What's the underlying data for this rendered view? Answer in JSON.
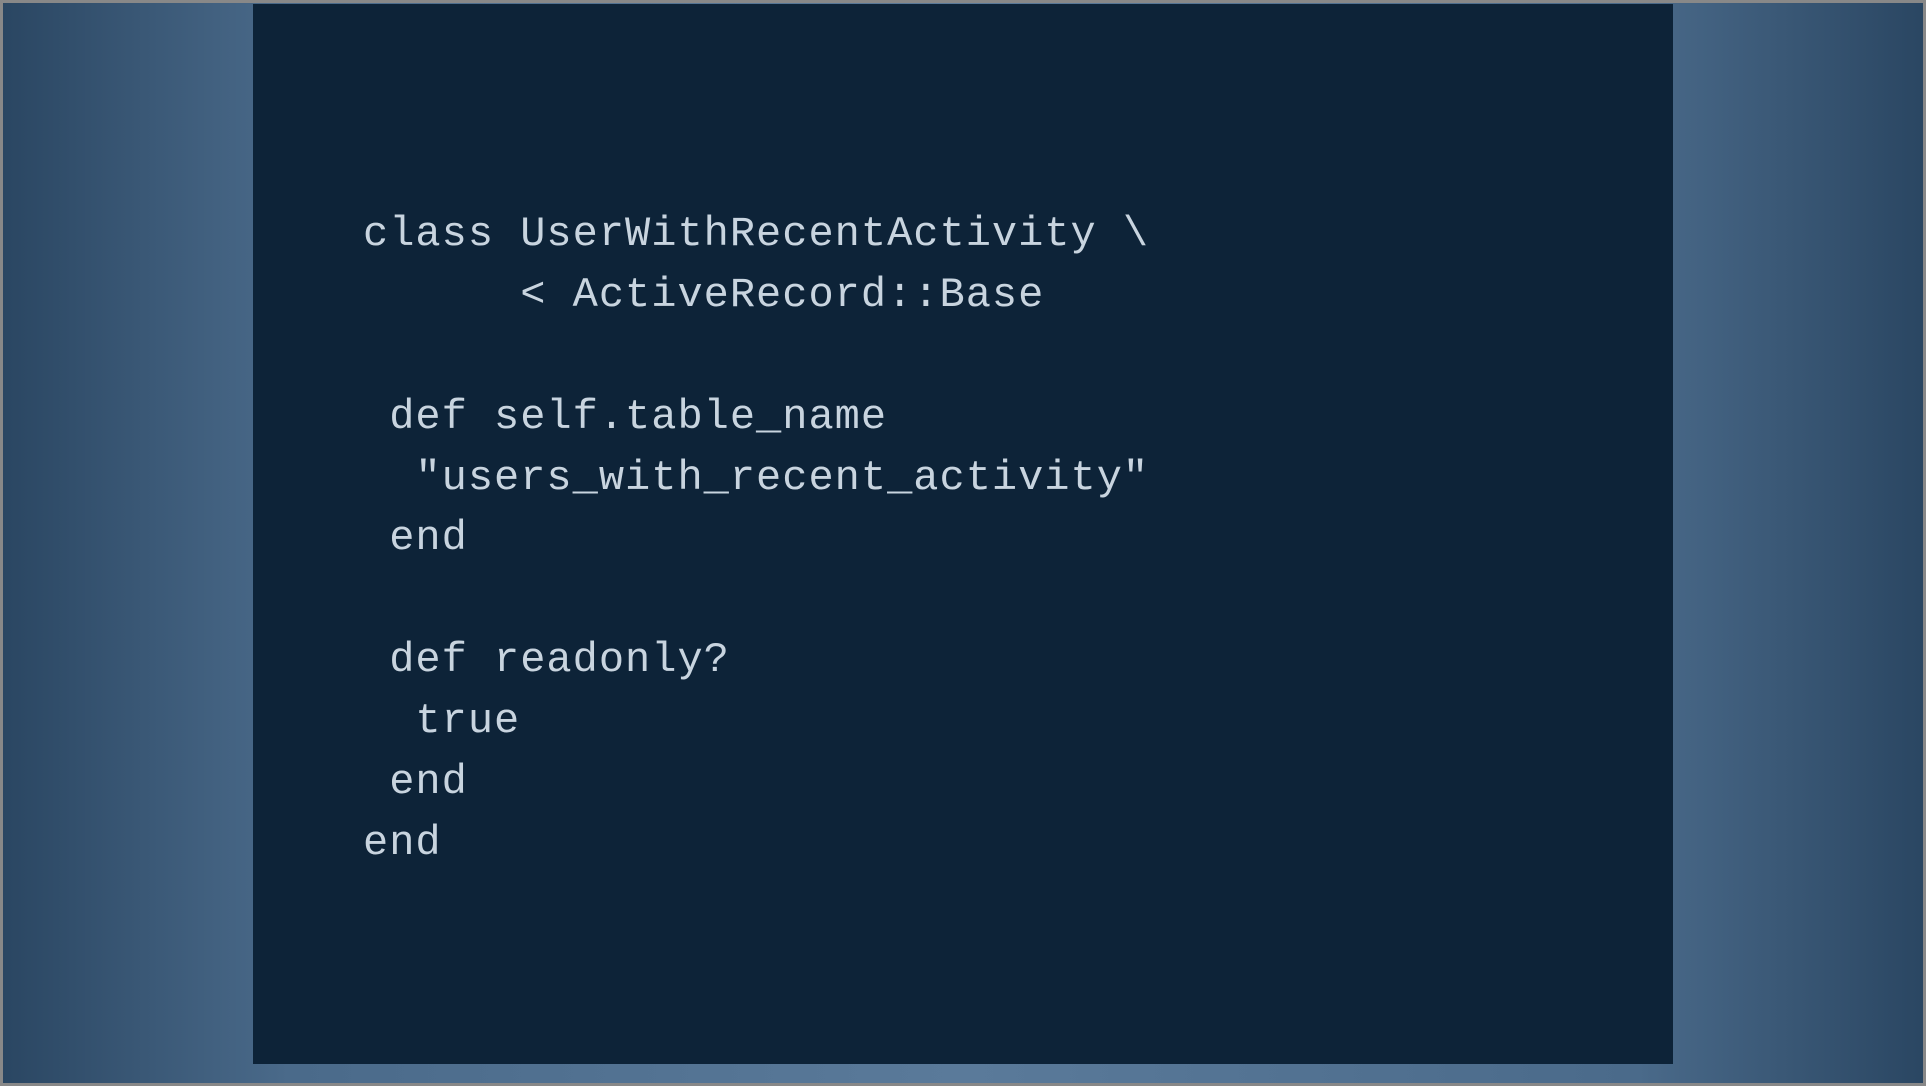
{
  "code": {
    "line1": "class UserWithRecentActivity \\",
    "line2": "      < ActiveRecord::Base",
    "line3": "",
    "line4": " def self.table_name",
    "line5": "  \"users_with_recent_activity\"",
    "line6": " end",
    "line7": "",
    "line8": " def readonly?",
    "line9": "  true",
    "line10": " end",
    "line11": "end"
  }
}
